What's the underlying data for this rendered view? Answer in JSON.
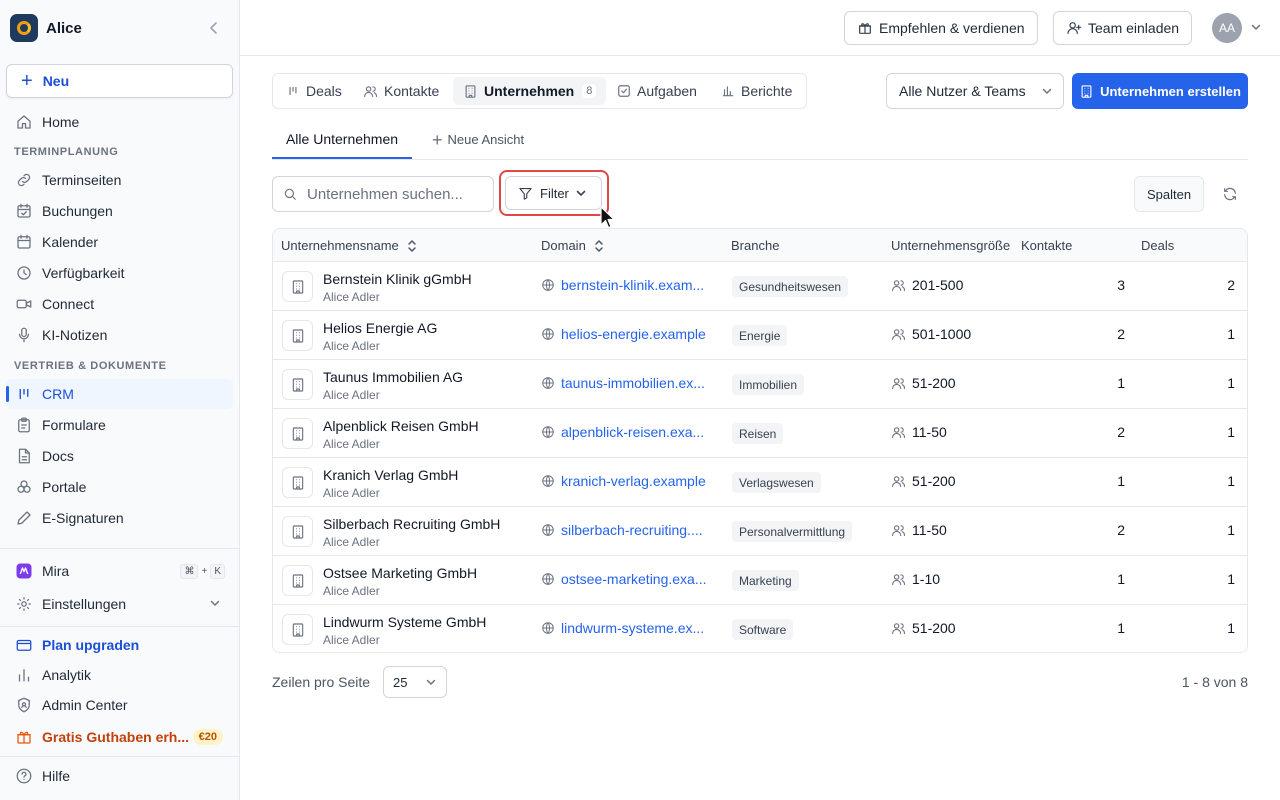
{
  "sidebar": {
    "workspace": "Alice",
    "new_label": "Neu",
    "items": [
      {
        "label": "Home",
        "icon": "home-icon"
      },
      {
        "label": "Terminseiten",
        "icon": "link-icon"
      },
      {
        "label": "Buchungen",
        "icon": "calendar-check-icon"
      },
      {
        "label": "Kalender",
        "icon": "calendar-icon"
      },
      {
        "label": "Verfügbarkeit",
        "icon": "clock-icon"
      },
      {
        "label": "Connect",
        "icon": "video-icon"
      },
      {
        "label": "KI-Notizen",
        "icon": "microphone-icon"
      },
      {
        "label": "CRM",
        "icon": "crm-icon"
      },
      {
        "label": "Formulare",
        "icon": "clipboard-icon"
      },
      {
        "label": "Docs",
        "icon": "document-icon"
      },
      {
        "label": "Portale",
        "icon": "portal-icon"
      },
      {
        "label": "E-Signaturen",
        "icon": "pen-icon"
      }
    ],
    "sections": {
      "scheduling": "TERMINPLANUNG",
      "sales": "VERTRIEB & DOKUMENTE"
    },
    "mira": {
      "label": "Mira",
      "shortcut": [
        "⌘",
        "+",
        "K"
      ]
    },
    "settings_label": "Einstellungen",
    "upgrade_label": "Plan upgraden",
    "analytics_label": "Analytik",
    "admin_label": "Admin Center",
    "credit_label": "Gratis Guthaben erh...",
    "credit_badge": "€20",
    "help_label": "Hilfe"
  },
  "topbar": {
    "refer_label": "Empfehlen & verdienen",
    "invite_label": "Team einladen",
    "avatar_initials": "AA"
  },
  "tabs": [
    {
      "label": "Deals"
    },
    {
      "label": "Kontakte"
    },
    {
      "label": "Unternehmen",
      "count": "8"
    },
    {
      "label": "Aufgaben"
    },
    {
      "label": "Berichte"
    }
  ],
  "user_filter": "Alle Nutzer & Teams",
  "create_label": "Unternehmen erstellen",
  "views": {
    "active": "Alle Unternehmen",
    "new_view": "Neue Ansicht"
  },
  "search": {
    "placeholder": "Unternehmen suchen..."
  },
  "filter_label": "Filter",
  "columns_label": "Spalten",
  "table": {
    "headers": {
      "name": "Unternehmensname",
      "domain": "Domain",
      "industry": "Branche",
      "size": "Unternehmensgröße",
      "contacts": "Kontakte",
      "deals": "Deals"
    },
    "rows": [
      {
        "name": "Bernstein Klinik gGmbH",
        "owner": "Alice Adler",
        "domain": "bernstein-klinik.exam...",
        "industry": "Gesundheitswesen",
        "size": "201-500",
        "contacts": "3",
        "deals": "2"
      },
      {
        "name": "Helios Energie AG",
        "owner": "Alice Adler",
        "domain": "helios-energie.example",
        "industry": "Energie",
        "size": "501-1000",
        "contacts": "2",
        "deals": "1"
      },
      {
        "name": "Taunus Immobilien AG",
        "owner": "Alice Adler",
        "domain": "taunus-immobilien.ex...",
        "industry": "Immobilien",
        "size": "51-200",
        "contacts": "1",
        "deals": "1"
      },
      {
        "name": "Alpenblick Reisen GmbH",
        "owner": "Alice Adler",
        "domain": "alpenblick-reisen.exa...",
        "industry": "Reisen",
        "size": "11-50",
        "contacts": "2",
        "deals": "1"
      },
      {
        "name": "Kranich Verlag GmbH",
        "owner": "Alice Adler",
        "domain": "kranich-verlag.example",
        "industry": "Verlagswesen",
        "size": "51-200",
        "contacts": "1",
        "deals": "1"
      },
      {
        "name": "Silberbach Recruiting GmbH",
        "owner": "Alice Adler",
        "domain": "silberbach-recruiting....",
        "industry": "Personalvermittlung",
        "size": "11-50",
        "contacts": "2",
        "deals": "1"
      },
      {
        "name": "Ostsee Marketing GmbH",
        "owner": "Alice Adler",
        "domain": "ostsee-marketing.exa...",
        "industry": "Marketing",
        "size": "1-10",
        "contacts": "1",
        "deals": "1"
      },
      {
        "name": "Lindwurm Systeme GmbH",
        "owner": "Alice Adler",
        "domain": "lindwurm-systeme.ex...",
        "industry": "Software",
        "size": "51-200",
        "contacts": "1",
        "deals": "1"
      }
    ]
  },
  "pagination": {
    "rows_per_page_label": "Zeilen pro Seite",
    "rows_per_page": "25",
    "info": "1 - 8 von 8"
  },
  "colors": {
    "accent": "#2563eb",
    "highlight": "#e04848"
  }
}
